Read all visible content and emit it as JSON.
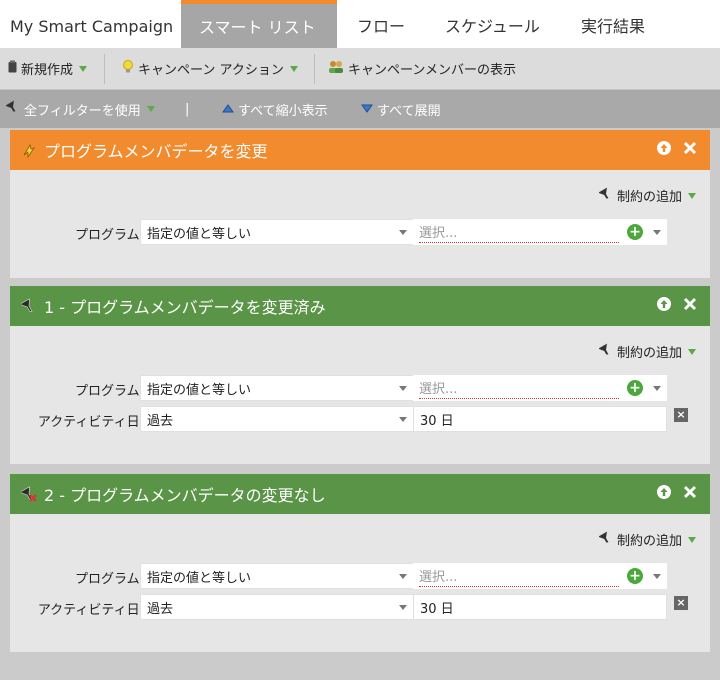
{
  "tabs": [
    {
      "label": "My Smart Campaign"
    },
    {
      "label": "スマート リスト"
    },
    {
      "label": "フロー"
    },
    {
      "label": "スケジュール"
    },
    {
      "label": "実行結果"
    }
  ],
  "toolbar1": {
    "new_label": "新規作成",
    "campaign_actions_label": "キャンペーン アクション",
    "show_members_label": "キャンペーンメンバーの表示"
  },
  "toolbar2": {
    "use_all_filters_label": "全フィルターを使用",
    "separator": "|",
    "collapse_all_label": "すべて縮小表示",
    "expand_all_label": "すべて展開"
  },
  "filters": [
    {
      "title": "プログラムメンバデータを変更",
      "color": "#f28a2e",
      "add_constraint": "制約の追加",
      "program_label": "プログラム:",
      "operator": "指定の値と等しい",
      "value_placeholder": "選択..."
    },
    {
      "title": "1 - プログラムメンバデータを変更済み",
      "color": "#5a9447",
      "add_constraint": "制約の追加",
      "program_label": "プログラム:",
      "operator": "指定の値と等しい",
      "value_placeholder": "選択...",
      "activity_label": "アクティビティ日:",
      "activity_operator": "過去",
      "activity_value": "30 日"
    },
    {
      "title": "2 - プログラムメンバデータの変更なし",
      "color": "#5a9447",
      "add_constraint": "制約の追加",
      "program_label": "プログラム:",
      "operator": "指定の値と等しい",
      "value_placeholder": "選択...",
      "activity_label": "アクティビティ日:",
      "activity_operator": "過去",
      "activity_value": "30 日"
    }
  ]
}
